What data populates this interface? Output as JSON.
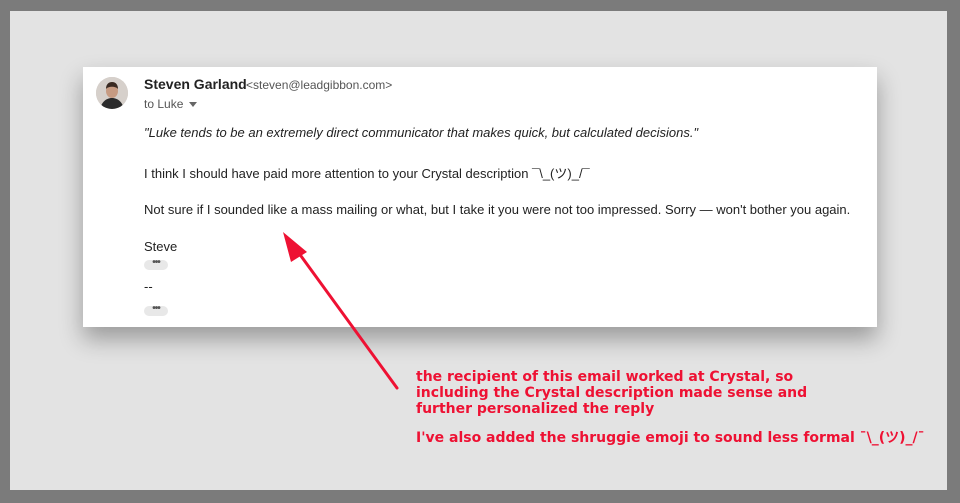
{
  "email": {
    "sender_name": "Steven Garland",
    "sender_email": "<steven@leadgibbon.com>",
    "recipient": "to Luke",
    "quote": "\"Luke tends to be an extremely direct communicator that makes quick, but calculated decisions.\"",
    "line2": "I think I should have paid more attention to your Crystal description ¯\\_(ツ)_/¯",
    "line3": "Not sure if I sounded like a mass mailing or what, but I take it you were not too impressed. Sorry — won't bother you again.",
    "signoff": "Steve",
    "dashes": "--",
    "ellipsis_label": "•••"
  },
  "annotations": {
    "note1_lines": [
      "the recipient of this email worked at Crystal, so",
      "including the Crystal description made sense and",
      "further personalized the reply"
    ],
    "note2": "I've also added the shruggie emoji to sound less formal ¯\\_(ツ)_/¯"
  },
  "colors": {
    "annotation": "#ee1133",
    "frame": "#7b7b7b",
    "backdrop": "#e3e3e3"
  },
  "icons": {
    "avatar": "profile-photo",
    "dropdown": "caret-down-icon",
    "arrow": "red-pointer-arrow"
  }
}
